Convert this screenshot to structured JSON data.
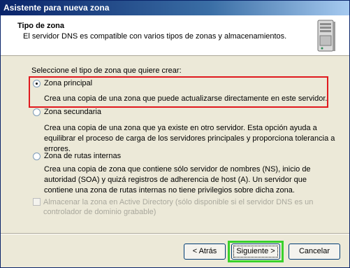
{
  "window": {
    "title": "Asistente para nueva zona"
  },
  "header": {
    "title": "Tipo de zona",
    "subtitle": "El servidor DNS es compatible con varios tipos de zonas y almacenamientos.",
    "icon": "server-icon"
  },
  "main": {
    "prompt": "Seleccione el tipo de zona que quiere crear:",
    "options": [
      {
        "label": "Zona principal",
        "selected": true,
        "description": "Crea una copia de una zona que puede actualizarse directamente en este servidor."
      },
      {
        "label": "Zona secundaria",
        "selected": false,
        "description": "Crea una copia de una zona que ya existe en otro servidor. Esta opción ayuda a equilibrar el proceso de carga de los servidores principales y proporciona tolerancia a errores."
      },
      {
        "label": "Zona de rutas internas",
        "selected": false,
        "description": "Crea una copia de zona que contiene sólo servidor de nombres (NS), inicio de autoridad (SOA) y quizá registros de adherencia de host (A). Un servidor que contiene una zona de rutas internas no tiene privilegios sobre dicha zona."
      }
    ],
    "store_ad": {
      "label": "Almacenar la zona en Active Directory (sólo disponible si el servidor DNS es un controlador de dominio grabable)",
      "checked": false,
      "enabled": false
    }
  },
  "footer": {
    "back_label": "< Atrás",
    "next_label": "Siguiente >",
    "cancel_label": "Cancelar"
  },
  "colors": {
    "highlight_primary": "#e0191e",
    "highlight_next": "#38d12b",
    "titlebar": "#0a246a"
  }
}
